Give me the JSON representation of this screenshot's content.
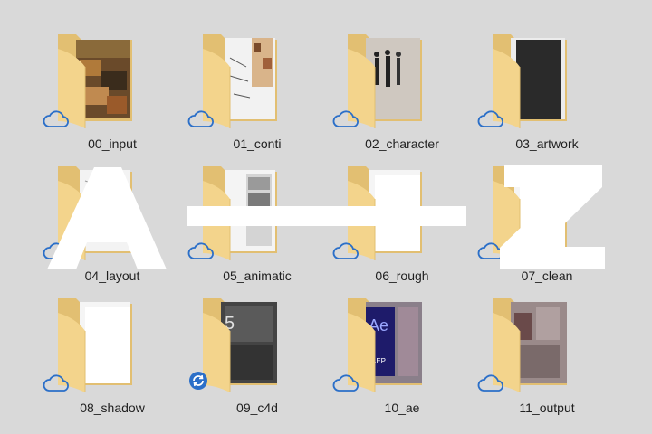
{
  "folders": [
    {
      "label": "00_input",
      "status": "cloud",
      "preview": "painting"
    },
    {
      "label": "01_conti",
      "status": "cloud",
      "preview": "sketch-color"
    },
    {
      "label": "02_character",
      "status": "cloud",
      "preview": "character-sheet"
    },
    {
      "label": "03_artwork",
      "status": "cloud",
      "preview": "dark-art"
    },
    {
      "label": "04_layout",
      "status": "cloud",
      "preview": "line-sketch"
    },
    {
      "label": "05_animatic",
      "status": "cloud",
      "preview": "storyboard"
    },
    {
      "label": "06_rough",
      "status": "cloud",
      "preview": "blank"
    },
    {
      "label": "07_clean",
      "status": "cloud",
      "preview": "blank"
    },
    {
      "label": "08_shadow",
      "status": "cloud",
      "preview": "blank"
    },
    {
      "label": "09_c4d",
      "status": "sync",
      "preview": "c4d-screen"
    },
    {
      "label": "10_ae",
      "status": "cloud",
      "preview": "ae-file"
    },
    {
      "label": "11_output",
      "status": "cloud",
      "preview": "city-photo"
    }
  ],
  "overlay": {
    "left_letter": "A",
    "right_letter": "Z"
  },
  "ae_icon_text": "Ae",
  "ae_icon_sub": "AEP",
  "c4d_icon_text": "5",
  "colors": {
    "background": "#d9d9d9",
    "folder_back": "#e7c77d",
    "folder_front": "#f5d68e",
    "cloud_stroke": "#2b6fc8",
    "overlay": "#ffffff"
  }
}
